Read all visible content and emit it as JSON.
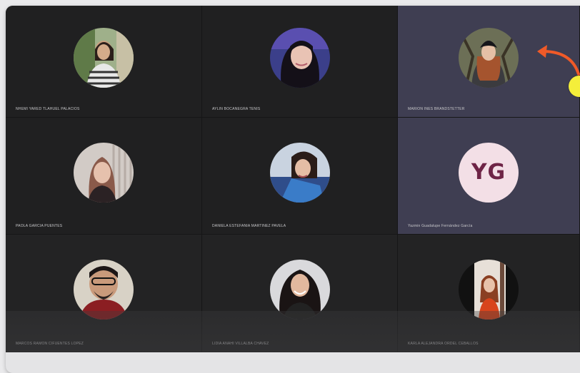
{
  "participants": [
    {
      "name": "NHEMI YARED TLAHUEL PALACIOS",
      "photo_icon": "participant-photo-icon"
    },
    {
      "name": "AYLIN BOCANEGRA TENIS",
      "photo_icon": "participant-photo-icon"
    },
    {
      "name": "MARION INES BRANDSTETTER",
      "photo_icon": "participant-photo-icon"
    },
    {
      "name": "PAOLA GARCIA PUENTES",
      "photo_icon": "participant-photo-icon"
    },
    {
      "name": "DANIELA ESTEFANIA MARTINEZ PAVELA",
      "photo_icon": "participant-photo-icon"
    },
    {
      "name": "Yazmin Guadalupe Fernández García",
      "initials": "YG"
    },
    {
      "name": "MARCOS RAMON CIFUENTES LOPEZ",
      "photo_icon": "participant-photo-icon"
    },
    {
      "name": "LIDIA ANAHI VILLALBA CHAVEZ",
      "photo_icon": "participant-photo-icon"
    },
    {
      "name": "KARLA ALEJANDRA ORDEL CEBALLOS",
      "photo_icon": "participant-photo-icon"
    }
  ],
  "colors": {
    "stage_bg": "#1b1b1c",
    "active_tile": "#3f3e52",
    "initials_bg": "#f3dfe6",
    "initials_text": "#6e2446",
    "annotation_arrow": "#f05a28",
    "annotation_marker": "#f4ee3a"
  }
}
